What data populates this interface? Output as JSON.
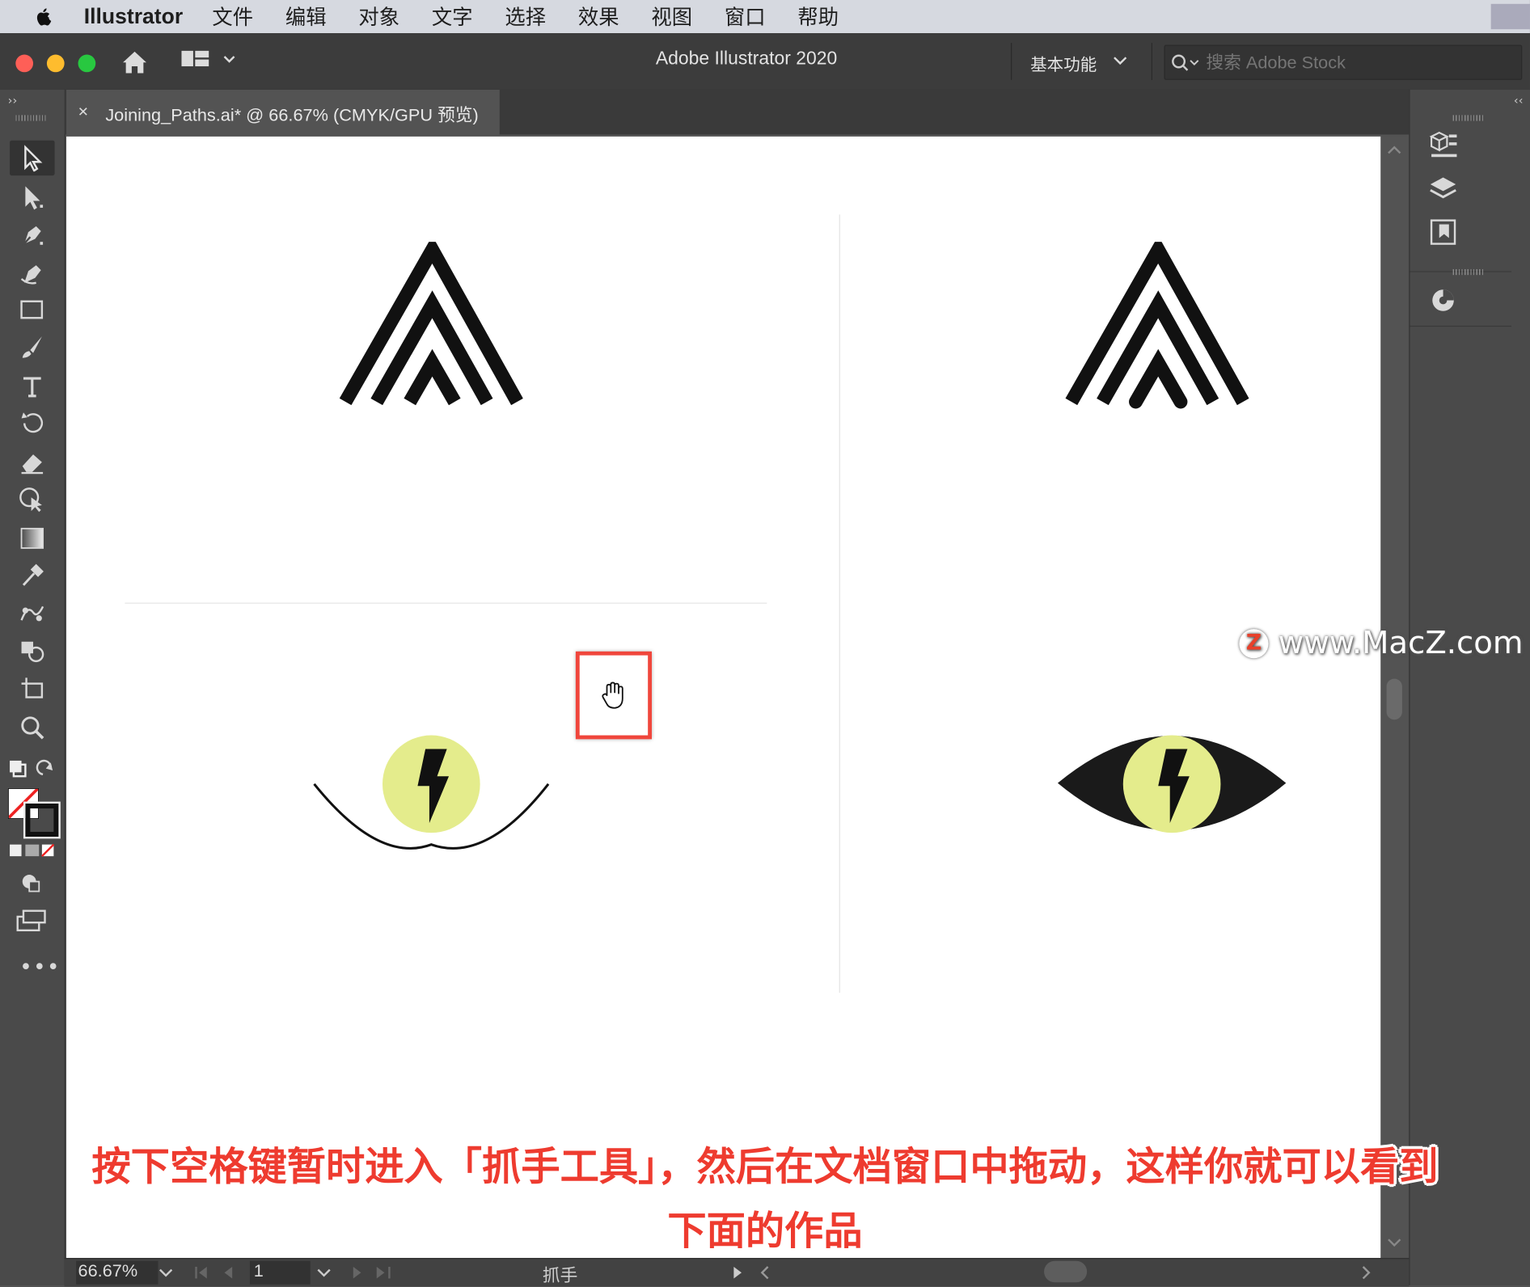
{
  "menubar": {
    "app": "Illustrator",
    "items": [
      "文件",
      "编辑",
      "对象",
      "文字",
      "选择",
      "效果",
      "视图",
      "窗口",
      "帮助"
    ]
  },
  "titlebar": {
    "title": "Adobe Illustrator 2020",
    "workspace": "基本功能",
    "search_placeholder": "搜索 Adobe Stock"
  },
  "tab": {
    "close": "×",
    "name": "Joining_Paths.ai* @ 66.67% (CMYK/GPU 预览)"
  },
  "status": {
    "zoom": "66.67%",
    "page": "1",
    "tool": "抓手"
  },
  "canvas": {
    "artwork_colors": {
      "stroke": "#111111",
      "eye_fill": "#e4ec8c",
      "eye_dark": "#1a1a1a"
    }
  },
  "watermark": {
    "logo": "Z",
    "text": "www.MacZ.com"
  },
  "caption": {
    "line1": "按下空格键暂时进入「抓手工具」，然后在文档窗口中拖动，这样你就可以看到",
    "line2": "下面的作品"
  },
  "icons": {
    "tools": [
      "selection-tool-icon",
      "direct-selection-tool-icon",
      "pen-tool-icon",
      "curvature-tool-icon",
      "rectangle-tool-icon",
      "paintbrush-tool-icon",
      "type-tool-icon",
      "rotate-tool-icon",
      "eraser-tool-icon",
      "puppet-warp-tool-icon",
      "gradient-tool-icon",
      "eyedropper-tool-icon",
      "blend-tool-icon",
      "shape-builder-tool-icon",
      "artboard-tool-icon",
      "zoom-tool-icon"
    ],
    "panels": [
      "properties-panel-icon",
      "layers-panel-icon",
      "libraries-panel-icon",
      "color-guide-panel-icon"
    ]
  }
}
